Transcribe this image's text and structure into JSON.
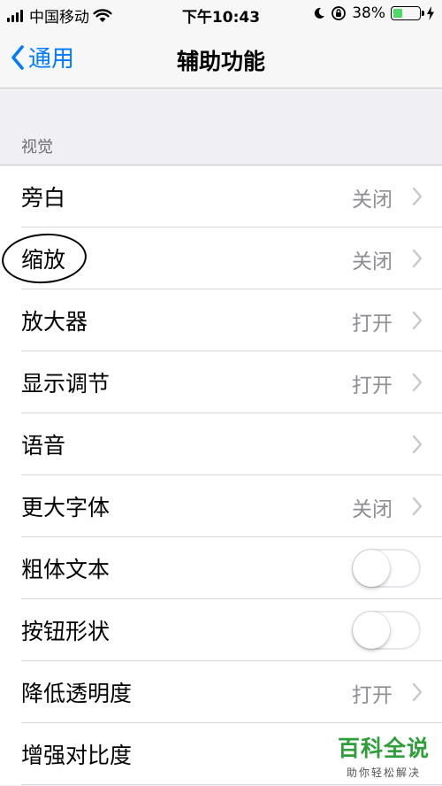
{
  "status_bar": {
    "carrier": "中国移动",
    "time": "下午10:43",
    "battery_percent": "38%",
    "battery_level": 0.38,
    "colors": {
      "battery_fill": "#4cd964"
    }
  },
  "nav": {
    "back_label": "通用",
    "title": "辅助功能",
    "accent_color": "#007aff"
  },
  "section": {
    "header": "视觉",
    "rows": [
      {
        "label": "旁白",
        "value": "关闭",
        "control": "chevron"
      },
      {
        "label": "缩放",
        "value": "关闭",
        "control": "chevron"
      },
      {
        "label": "放大器",
        "value": "打开",
        "control": "chevron"
      },
      {
        "label": "显示调节",
        "value": "打开",
        "control": "chevron"
      },
      {
        "label": "语音",
        "value": "",
        "control": "chevron"
      },
      {
        "label": "更大字体",
        "value": "关闭",
        "control": "chevron"
      },
      {
        "label": "粗体文本",
        "value": "",
        "control": "toggle",
        "on": false
      },
      {
        "label": "按钮形状",
        "value": "",
        "control": "toggle",
        "on": false
      },
      {
        "label": "降低透明度",
        "value": "打开",
        "control": "chevron"
      },
      {
        "label": "增强对比度",
        "value": "",
        "control": "none"
      }
    ]
  },
  "watermark": {
    "brand": "百科全说",
    "slogan": "助你轻松解决"
  }
}
